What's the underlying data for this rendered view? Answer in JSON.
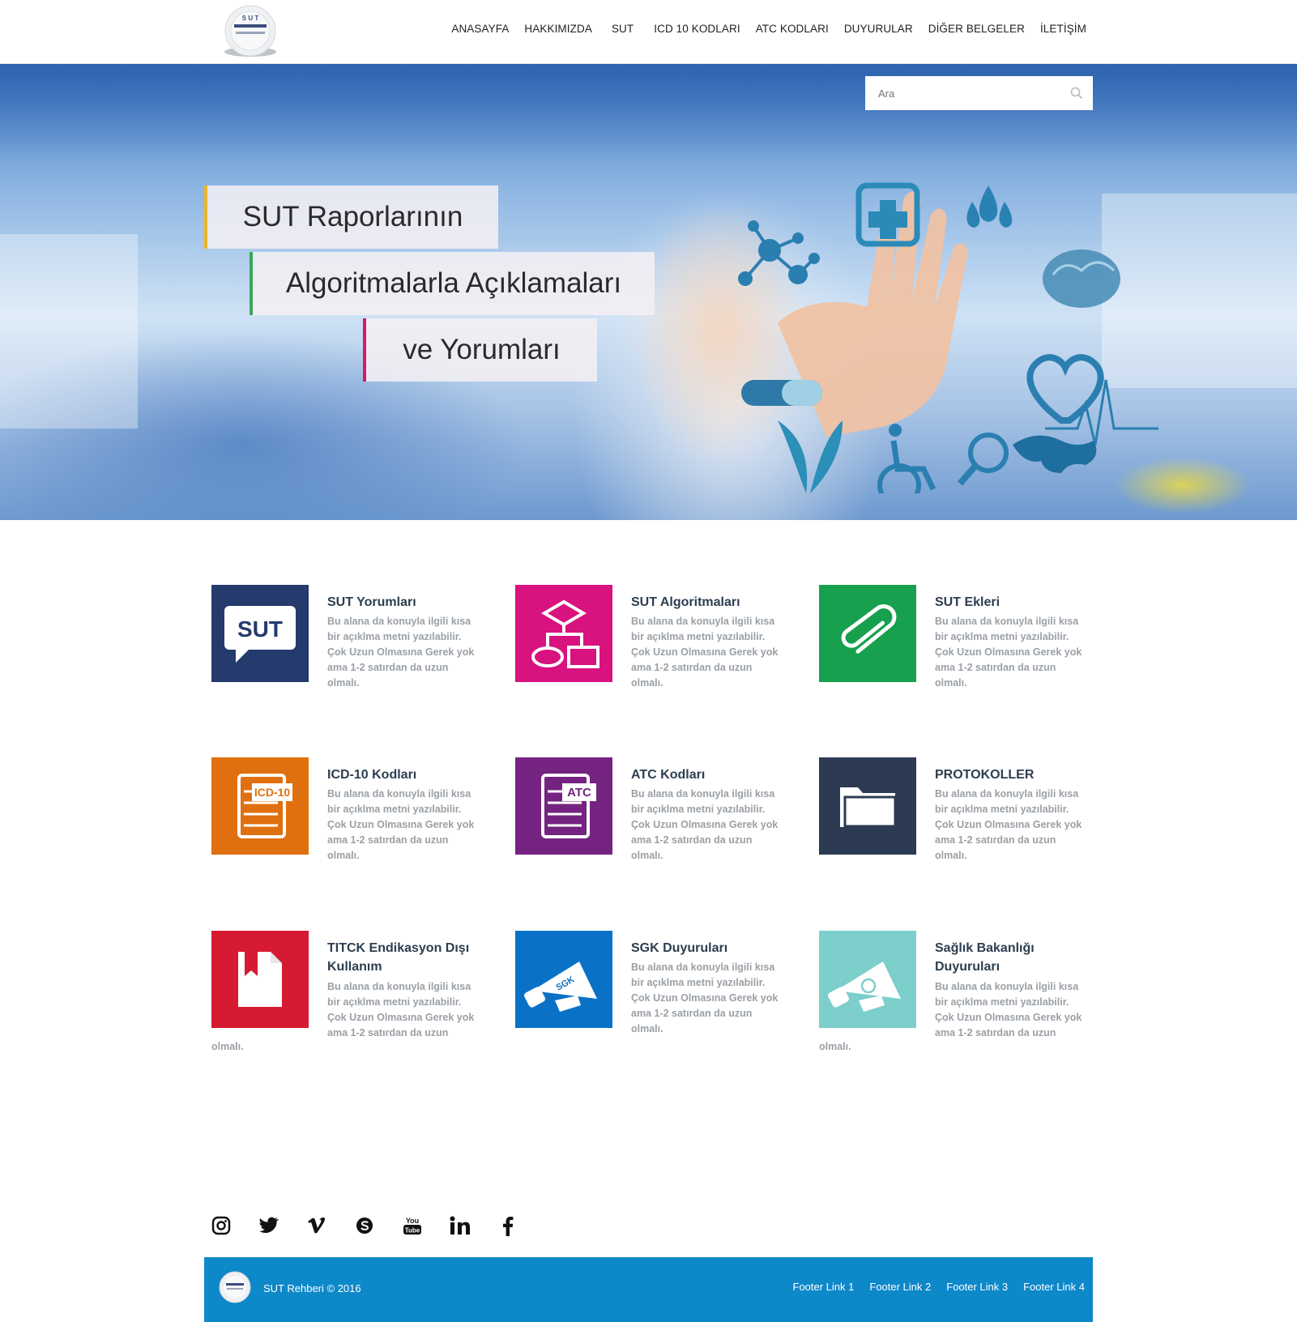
{
  "header": {
    "logo_icon": "sut-rehberi-logo",
    "nav": [
      {
        "label": "ANASAYFA"
      },
      {
        "label": "HAKKIMIZDA"
      },
      {
        "label": "SUT"
      },
      {
        "label": "ICD 10 KODLARI"
      },
      {
        "label": "ATC KODLARI"
      },
      {
        "label": "DUYURULAR"
      },
      {
        "label": "DİĞER BELGELER"
      },
      {
        "label": "İLETİŞİM"
      }
    ]
  },
  "hero": {
    "search": {
      "placeholder": "Ara",
      "icon": "search-icon"
    },
    "banner_lines": [
      "SUT Raporlarının",
      "Algoritmalarla Açıklamaları",
      "ve Yorumları"
    ],
    "accent_colors": {
      "line1": "#e9b52d",
      "line2": "#3aa65a",
      "line3": "#d6186f"
    }
  },
  "features": [
    {
      "title": "SUT Yorumları",
      "desc": "Bu alana da konuyla ilgili kısa bir açıklma metni yazılabilir. Çok Uzun Olmasına Gerek yok ama 1-2 satırdan da uzun olmalı.",
      "color": "#253b6e",
      "icon": "sut-speech-bubble-icon"
    },
    {
      "title": "SUT Algoritmaları",
      "desc": "Bu alana da konuyla ilgili kısa bir açıklma metni yazılabilir. Çok Uzun Olmasına Gerek yok ama 1-2 satırdan da uzun olmalı.",
      "color": "#d8127e",
      "icon": "flowchart-icon"
    },
    {
      "title": "SUT Ekleri",
      "desc": "Bu alana da konuyla ilgili kısa bir açıklma metni yazılabilir. Çok Uzun Olmasına Gerek yok ama 1-2 satırdan da uzun olmalı.",
      "color": "#17a04e",
      "icon": "paperclip-icon"
    },
    {
      "title": "ICD-10 Kodları",
      "desc": "Bu alana da konuyla ilgili kısa bir açıklma metni yazılabilir. Çok Uzun Olmasına Gerek yok ama 1-2 satırdan da uzun olmalı.",
      "color": "#e0700f",
      "icon": "icd10-document-icon",
      "icon_label": "ICD-10"
    },
    {
      "title": "ATC Kodları",
      "desc": "Bu alana da konuyla ilgili kısa bir açıklma metni yazılabilir. Çok Uzun Olmasına Gerek yok ama 1-2 satırdan da uzun olmalı.",
      "color": "#742380",
      "icon": "atc-document-icon",
      "icon_label": "ATC"
    },
    {
      "title": "PROTOKOLLER",
      "desc": "Bu alana da konuyla ilgili kısa bir açıklma metni yazılabilir. Çok Uzun Olmasına Gerek yok ama 1-2 satırdan da uzun olmalı.",
      "color": "#2c3b53",
      "icon": "folder-icon"
    },
    {
      "title": "TITCK Endikasyon Dışı Kullanım",
      "desc": "Bu alana da konuyla ilgili kısa bir açıklma metni yazılabilir. Çok Uzun Olmasına Gerek yok ama 1-2 satırdan da uzun",
      "tail": "olmalı.",
      "color": "#d51a31",
      "icon": "bookmark-document-icon"
    },
    {
      "title": "SGK Duyuruları",
      "desc": "Bu alana da konuyla ilgili kısa bir açıklma metni yazılabilir. Çok Uzun Olmasına Gerek yok ama 1-2 satırdan da uzun olmalı.",
      "color": "#0a72c6",
      "icon": "sgk-megaphone-icon",
      "icon_label": "SGK"
    },
    {
      "title": "Sağlık Bakanlığı Duyuruları",
      "desc": "Bu alana da konuyla ilgili kısa bir açıklma metni yazılabilir. Çok Uzun Olmasına Gerek yok ama 1-2 satırdan da uzun",
      "tail": "olmalı.",
      "color": "#7ccfcb",
      "icon": "ministry-megaphone-icon"
    }
  ],
  "social": [
    "instagram-icon",
    "twitter-icon",
    "vimeo-icon",
    "skype-icon",
    "youtube-icon",
    "linkedin-icon",
    "facebook-icon"
  ],
  "footer": {
    "copyright": "SUT Rehberi © 2016",
    "links": [
      "Footer Link 1",
      "Footer Link 2",
      "Footer Link 3",
      "Footer Link 4"
    ],
    "background": "#0d88c9"
  }
}
